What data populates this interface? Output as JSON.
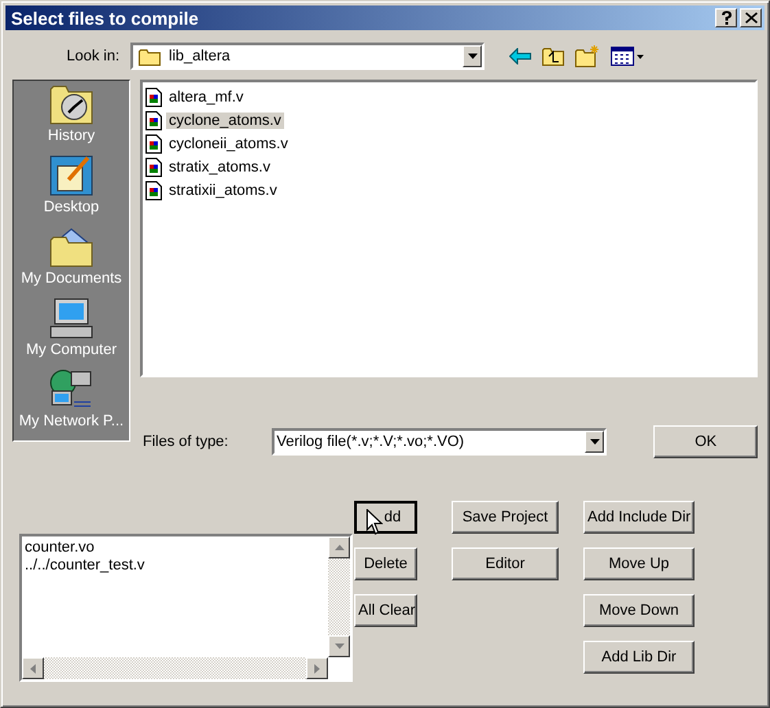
{
  "window": {
    "title": "Select files to compile"
  },
  "look_in": {
    "label": "Look in:",
    "value": "lib_altera"
  },
  "places": [
    {
      "kind": "history",
      "label": "History"
    },
    {
      "kind": "desktop",
      "label": "Desktop"
    },
    {
      "kind": "documents",
      "label": "My Documents"
    },
    {
      "kind": "computer",
      "label": "My Computer"
    },
    {
      "kind": "network",
      "label": "My Network P..."
    }
  ],
  "files": [
    {
      "name": "altera_mf.v",
      "selected": false
    },
    {
      "name": "cyclone_atoms.v",
      "selected": true
    },
    {
      "name": "cycloneii_atoms.v",
      "selected": false
    },
    {
      "name": "stratix_atoms.v",
      "selected": false
    },
    {
      "name": "stratixii_atoms.v",
      "selected": false
    }
  ],
  "file_type": {
    "label": "Files of type:",
    "value": "Verilog file(*.v;*.V;*.vo;*.VO)"
  },
  "ok_button": "OK",
  "compile_list": [
    "counter.vo",
    "../../counter_test.v"
  ],
  "button_columns": [
    [
      {
        "label": "dd",
        "focused": true
      },
      {
        "label": "Delete",
        "focused": false
      },
      {
        "label": "All Clear",
        "focused": false
      }
    ],
    [
      {
        "label": "Save Project",
        "focused": false
      },
      {
        "label": "Editor",
        "focused": false
      }
    ],
    [
      {
        "label": "Add Include Dir",
        "focused": false
      },
      {
        "label": "Move Up",
        "focused": false
      },
      {
        "label": "Move Down",
        "focused": false
      },
      {
        "label": "Add Lib Dir",
        "focused": false
      }
    ]
  ]
}
